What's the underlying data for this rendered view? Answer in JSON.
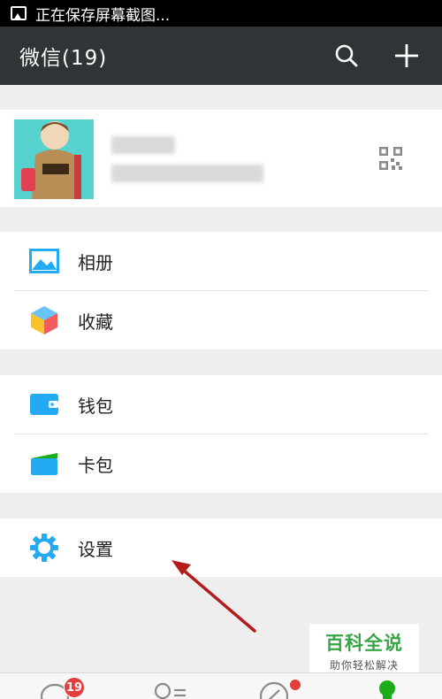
{
  "status_bar": {
    "text": "正在保存屏幕截图...",
    "icon": "image-icon"
  },
  "header": {
    "title": "微信(19)",
    "search_icon": "search-icon",
    "add_icon": "plus-icon"
  },
  "profile": {
    "avatar": "avatar-image",
    "qr_icon": "qr-code-icon"
  },
  "menu": {
    "album": {
      "label": "相册",
      "icon": "photo-album-icon"
    },
    "favorites": {
      "label": "收藏",
      "icon": "favorites-cube-icon"
    },
    "wallet": {
      "label": "钱包",
      "icon": "wallet-icon"
    },
    "cards": {
      "label": "卡包",
      "icon": "card-pack-icon"
    },
    "settings": {
      "label": "设置",
      "icon": "gear-icon"
    }
  },
  "watermark": {
    "main": "百科全说",
    "sub": "助你轻松解决"
  },
  "tabbar": {
    "chats_badge": "19",
    "icons": [
      "chat-bubble-icon",
      "contacts-icon",
      "compass-icon",
      "me-icon"
    ]
  },
  "colors": {
    "header_bg": "#2f3436",
    "accent_blue": "#23aaf2",
    "accent_green": "#1aad19",
    "badge_red": "#e33d3d"
  }
}
